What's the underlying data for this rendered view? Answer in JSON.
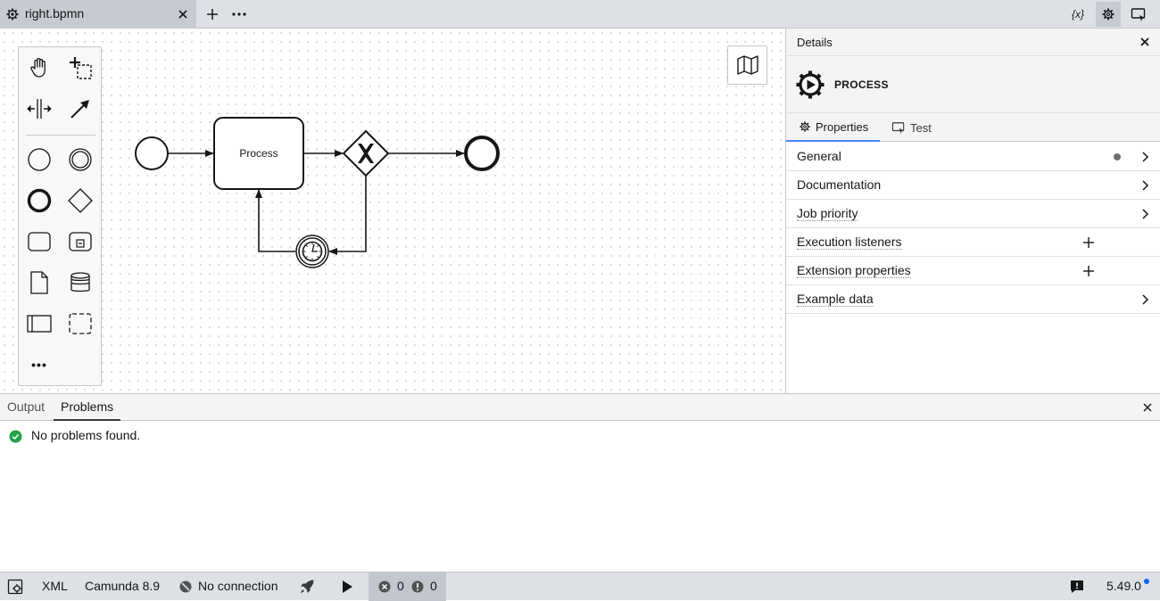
{
  "tabbar": {
    "tab_label": "right.bpmn",
    "icons": [
      "gear-icon",
      "close-icon",
      "plus-icon",
      "overflow-icon",
      "variables-icon",
      "settings-icon",
      "panel-toggle-icon"
    ],
    "variables_label": "{x}"
  },
  "palette": {
    "tools": [
      "hand-tool",
      "lasso-tool",
      "space-tool",
      "connect-tool",
      "start-event",
      "intermediate-event",
      "end-event",
      "gateway",
      "task",
      "subprocess",
      "data-object",
      "data-store",
      "pool",
      "group"
    ],
    "more_label": "•••"
  },
  "diagram": {
    "task_label": "Process",
    "elements": [
      "start-event",
      "task",
      "exclusive-gateway",
      "end-event",
      "timer-event"
    ]
  },
  "details": {
    "title": "Details",
    "element_type": "PROCESS",
    "tabs": [
      "Properties",
      "Test"
    ],
    "groups": [
      {
        "label": "General",
        "action": "chevron",
        "has_dot": true
      },
      {
        "label": "Documentation",
        "action": "chevron",
        "has_dot": false
      },
      {
        "label": "Job priority",
        "action": "chevron",
        "has_dot": false
      },
      {
        "label": "Execution listeners",
        "action": "add",
        "has_dot": false
      },
      {
        "label": "Extension properties",
        "action": "add",
        "has_dot": false
      },
      {
        "label": "Example data",
        "action": "chevron",
        "has_dot": false
      }
    ]
  },
  "bottom_panel": {
    "tabs": [
      "Output",
      "Problems"
    ],
    "active_tab": "Problems",
    "message": "No problems found."
  },
  "statusbar": {
    "xml_label": "XML",
    "engine": "Camunda 8.9",
    "connection": "No connection",
    "error_count": "0",
    "warning_count": "0",
    "version": "5.49.0"
  },
  "colors": {
    "accent": "#4589ff",
    "success": "#24a148",
    "bar": "#dde1e6"
  }
}
